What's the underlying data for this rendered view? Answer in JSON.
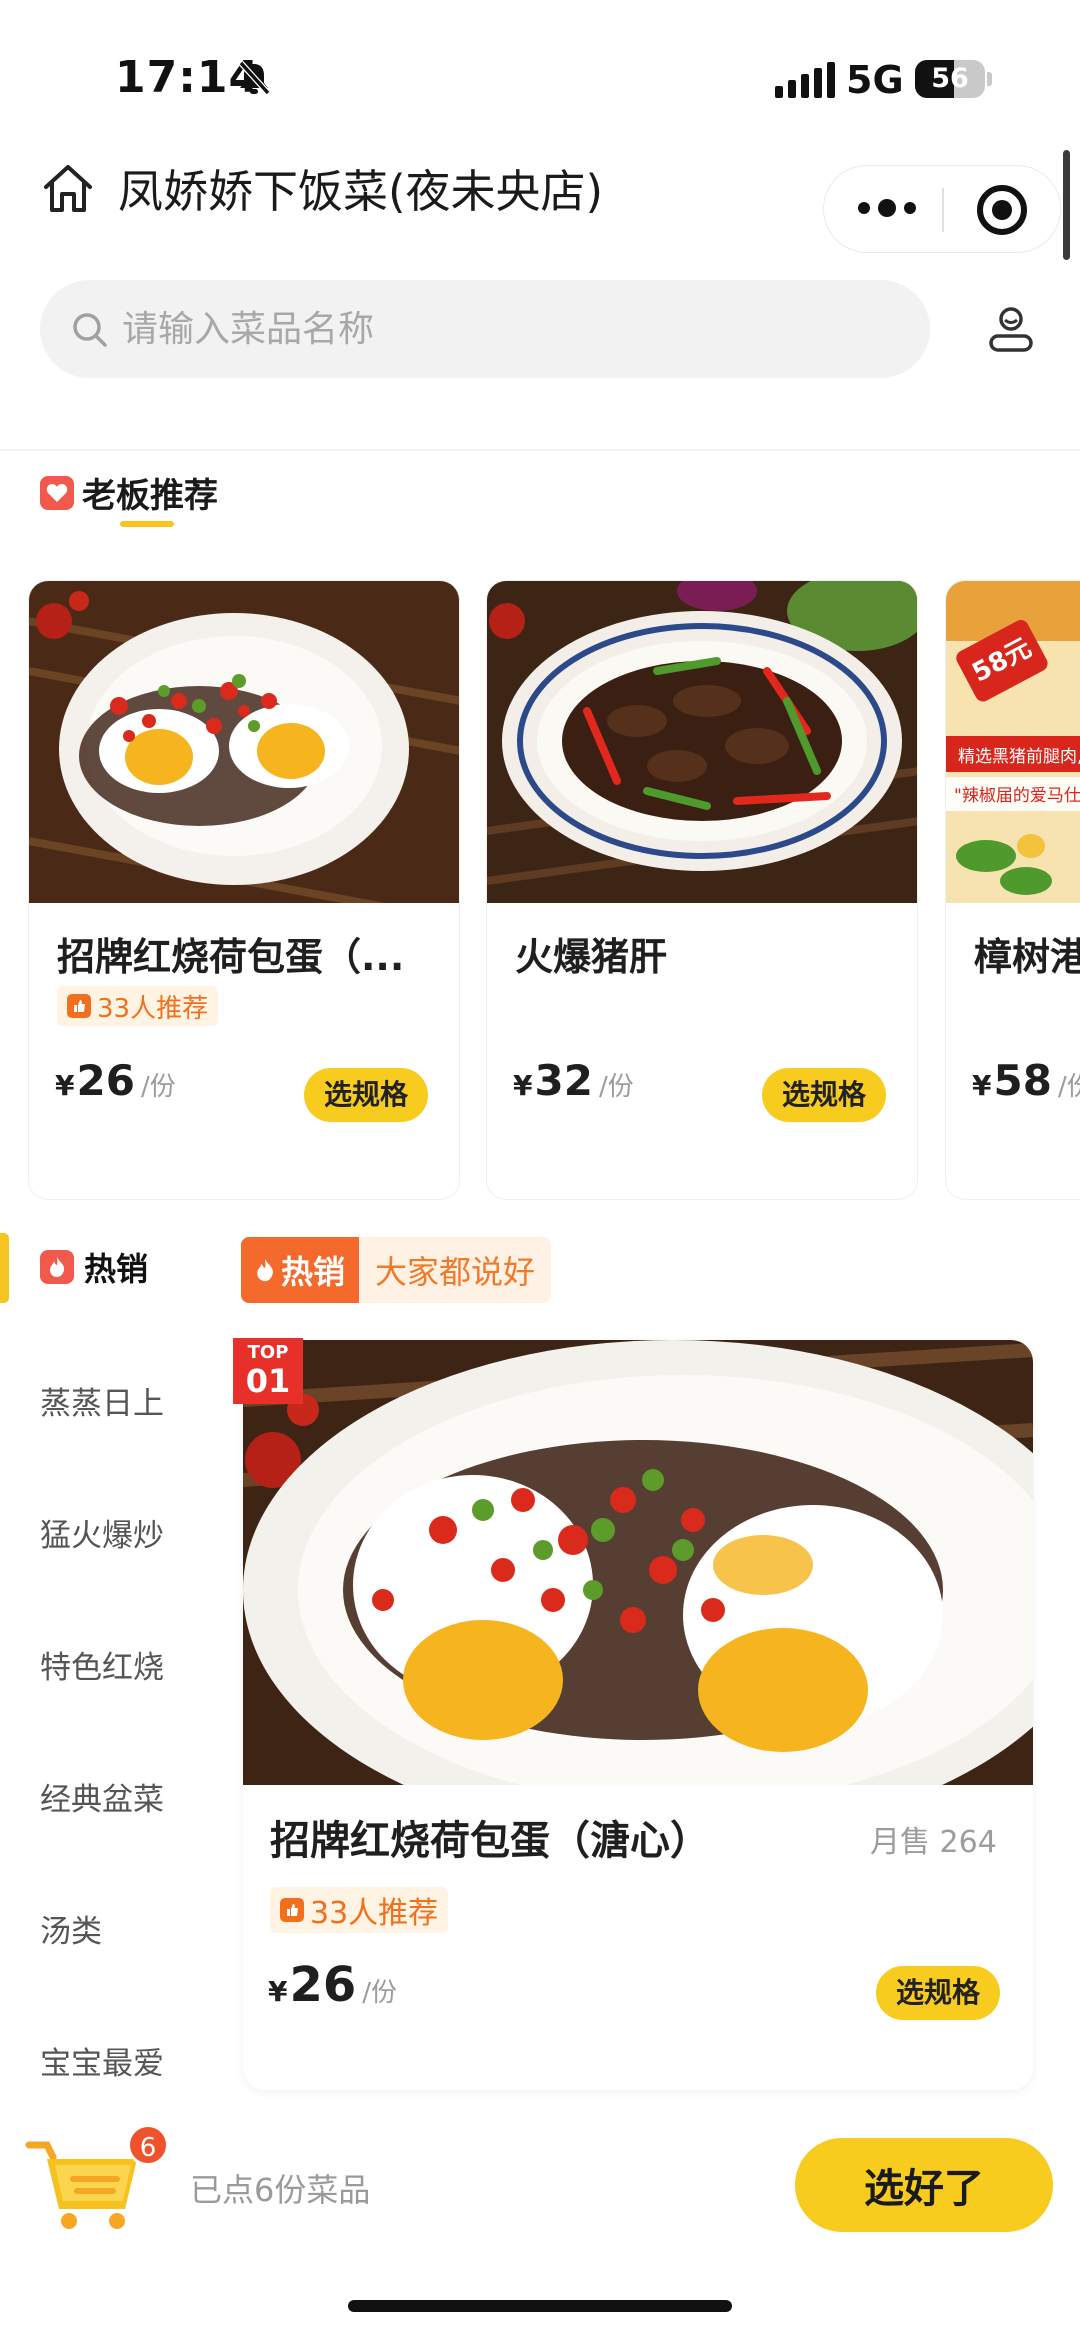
{
  "status_bar": {
    "time": "17:14",
    "network": "5G",
    "battery": "56",
    "battery_level": 0.56
  },
  "header": {
    "store_name": "凤娇娇下饭菜(夜未央店)"
  },
  "search": {
    "placeholder": "请输入菜品名称"
  },
  "recommend": {
    "title": "老板推荐",
    "items": [
      {
        "name": "招牌红烧荷包蛋（...",
        "rec_tag": "33人推荐",
        "currency": "¥",
        "price": "26",
        "unit": "/份",
        "button": "选规格"
      },
      {
        "name": "火爆猪肝",
        "currency": "¥",
        "price": "32",
        "unit": "/份",
        "button": "选规格"
      },
      {
        "name": "樟树港",
        "currency": "¥",
        "price": "58",
        "unit": "/份",
        "promo_price": "58元",
        "promo_line1": "精选黑猪前腿肉,",
        "promo_line2": "\"辣椒届的爱马仕"
      }
    ]
  },
  "categories": {
    "active": "热销",
    "items": [
      "蒸蒸日上",
      "猛火爆炒",
      "特色红烧",
      "经典盆菜",
      "汤类",
      "宝宝最爱"
    ]
  },
  "hot_section": {
    "tag_main": "热销",
    "tag_sub": "大家都说好",
    "item": {
      "rank_top": "TOP",
      "rank_no": "01",
      "name": "招牌红烧荷包蛋（溏心）",
      "sold": "月售 264",
      "rec_tag": "33人推荐",
      "currency": "¥",
      "price": "26",
      "unit": "/份",
      "button": "选规格"
    }
  },
  "cart": {
    "count": "6",
    "text": "已点6份菜品",
    "checkout": "选好了"
  },
  "colors": {
    "accent": "#f7cc1f",
    "hot": "#f46a2c",
    "badge": "#f0522c",
    "recommend_text": "#f2701c"
  }
}
